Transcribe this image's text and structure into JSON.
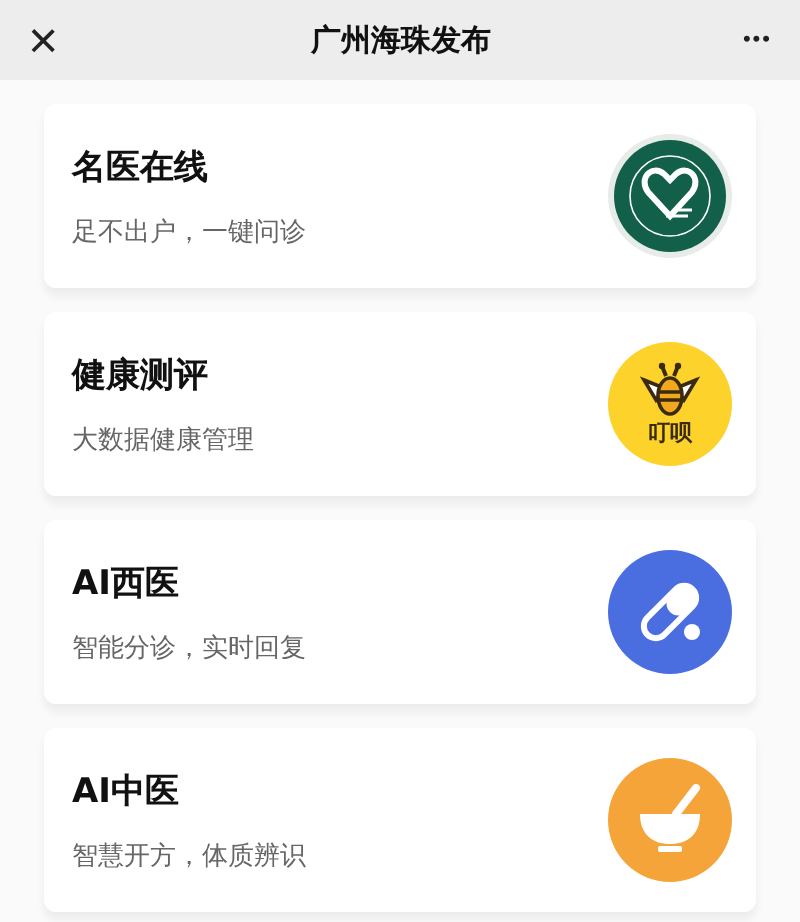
{
  "header": {
    "close": "×",
    "title": "广州海珠发布",
    "more": "•••"
  },
  "services": [
    {
      "title": "名医在线",
      "subtitle": "足不出户，一键问诊",
      "kind": "hospital"
    },
    {
      "title": "健康测评",
      "subtitle": "大数据健康管理",
      "kind": "bee",
      "icon_text": "叮呗"
    },
    {
      "title": "AI西医",
      "subtitle": "智能分诊，实时回复",
      "kind": "pill"
    },
    {
      "title": "AI中医",
      "subtitle": "智慧开方，体质辨识",
      "kind": "bowl"
    }
  ]
}
